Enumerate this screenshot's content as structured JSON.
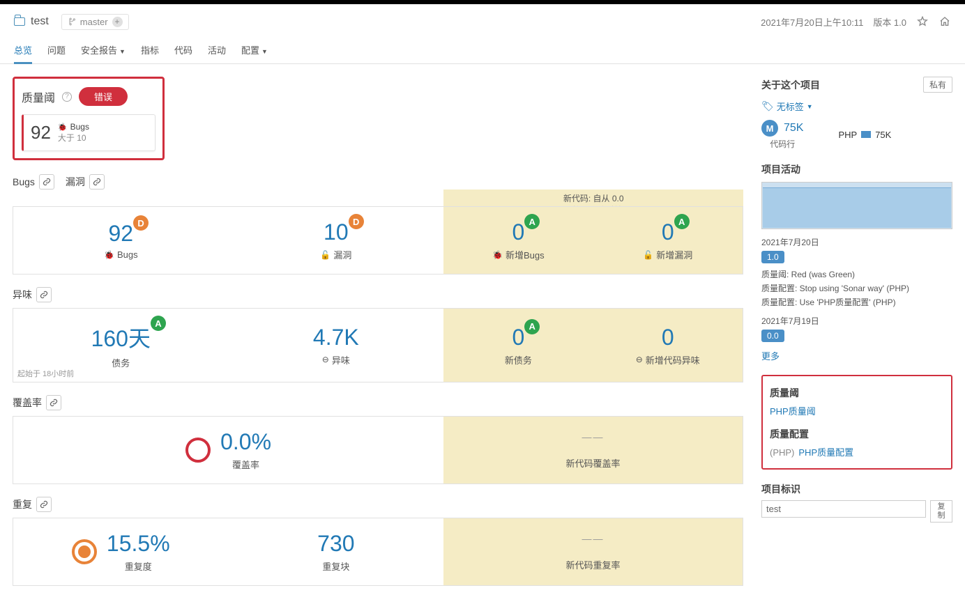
{
  "header": {
    "project_name": "test",
    "branch": "master",
    "timestamp": "2021年7月20日上午10:11",
    "version_label": "版本 1.0"
  },
  "tabs": [
    "总览",
    "问题",
    "安全报告",
    "指标",
    "代码",
    "活动",
    "配置"
  ],
  "quality_gate": {
    "title": "质量阈",
    "status": "错误",
    "metric_value": "92",
    "metric_label": "Bugs",
    "condition": "大于 10"
  },
  "new_code": {
    "title": "新代码: 自从 0.0",
    "subtitle": "起始于 18小时前"
  },
  "bugs_section": {
    "title1": "Bugs",
    "title2": "漏洞",
    "bugs_value": "92",
    "bugs_rating": "D",
    "bugs_label": "Bugs",
    "vuln_value": "10",
    "vuln_rating": "D",
    "vuln_label": "漏洞",
    "new_bugs_value": "0",
    "new_bugs_rating": "A",
    "new_bugs_label": "新增Bugs",
    "new_vuln_value": "0",
    "new_vuln_rating": "A",
    "new_vuln_label": "新增漏洞"
  },
  "smells_section": {
    "title": "异味",
    "debt_value": "160天",
    "debt_rating": "A",
    "debt_label": "债务",
    "smells_value": "4.7K",
    "smells_label": "异味",
    "new_debt_value": "0",
    "new_debt_rating": "A",
    "new_debt_label": "新债务",
    "new_smells_value": "0",
    "new_smells_label": "新增代码异味",
    "footnote": "起始于 18小时前"
  },
  "coverage_section": {
    "title": "覆盖率",
    "value": "0.0%",
    "label": "覆盖率",
    "new_label": "新代码覆盖率",
    "placeholder": "——"
  },
  "dup_section": {
    "title": "重复",
    "dup_value": "15.5%",
    "dup_label": "重复度",
    "blocks_value": "730",
    "blocks_label": "重复块",
    "new_label": "新代码重复率",
    "placeholder": "——"
  },
  "sidebar": {
    "about_title": "关于这个项目",
    "private_btn": "私有",
    "no_tags": "无标签",
    "loc_value": "75K",
    "loc_label": "代码行",
    "lang": "PHP",
    "lang_value": "75K",
    "activity_title": "项目活动",
    "history": [
      {
        "date": "2021年7月20日",
        "version": "1.0",
        "lines": [
          "质量阈: Red (was Green)",
          "质量配置: Stop using 'Sonar way' (PHP)",
          "质量配置: Use 'PHP质量配置' (PHP)"
        ]
      },
      {
        "date": "2021年7月19日",
        "version": "0.0",
        "lines": []
      }
    ],
    "more": "更多",
    "qg_title": "质量阈",
    "qg_link": "PHP质量阈",
    "qp_title": "质量配置",
    "qp_lang": "(PHP)",
    "qp_link": "PHP质量配置",
    "key_title": "项目标识",
    "key_value": "test",
    "copy_label": "复制"
  }
}
